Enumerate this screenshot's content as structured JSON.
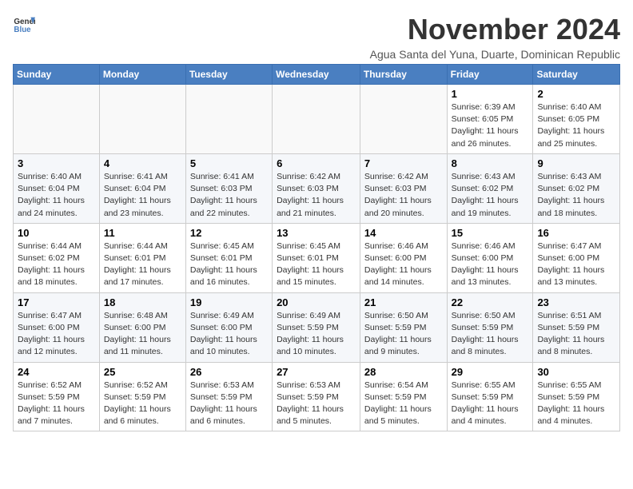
{
  "logo": {
    "general": "General",
    "blue": "Blue"
  },
  "title": "November 2024",
  "subtitle": "Agua Santa del Yuna, Duarte, Dominican Republic",
  "days_header": [
    "Sunday",
    "Monday",
    "Tuesday",
    "Wednesday",
    "Thursday",
    "Friday",
    "Saturday"
  ],
  "weeks": [
    [
      {
        "day": "",
        "info": ""
      },
      {
        "day": "",
        "info": ""
      },
      {
        "day": "",
        "info": ""
      },
      {
        "day": "",
        "info": ""
      },
      {
        "day": "",
        "info": ""
      },
      {
        "day": "1",
        "info": "Sunrise: 6:39 AM\nSunset: 6:05 PM\nDaylight: 11 hours and 26 minutes."
      },
      {
        "day": "2",
        "info": "Sunrise: 6:40 AM\nSunset: 6:05 PM\nDaylight: 11 hours and 25 minutes."
      }
    ],
    [
      {
        "day": "3",
        "info": "Sunrise: 6:40 AM\nSunset: 6:04 PM\nDaylight: 11 hours and 24 minutes."
      },
      {
        "day": "4",
        "info": "Sunrise: 6:41 AM\nSunset: 6:04 PM\nDaylight: 11 hours and 23 minutes."
      },
      {
        "day": "5",
        "info": "Sunrise: 6:41 AM\nSunset: 6:03 PM\nDaylight: 11 hours and 22 minutes."
      },
      {
        "day": "6",
        "info": "Sunrise: 6:42 AM\nSunset: 6:03 PM\nDaylight: 11 hours and 21 minutes."
      },
      {
        "day": "7",
        "info": "Sunrise: 6:42 AM\nSunset: 6:03 PM\nDaylight: 11 hours and 20 minutes."
      },
      {
        "day": "8",
        "info": "Sunrise: 6:43 AM\nSunset: 6:02 PM\nDaylight: 11 hours and 19 minutes."
      },
      {
        "day": "9",
        "info": "Sunrise: 6:43 AM\nSunset: 6:02 PM\nDaylight: 11 hours and 18 minutes."
      }
    ],
    [
      {
        "day": "10",
        "info": "Sunrise: 6:44 AM\nSunset: 6:02 PM\nDaylight: 11 hours and 18 minutes."
      },
      {
        "day": "11",
        "info": "Sunrise: 6:44 AM\nSunset: 6:01 PM\nDaylight: 11 hours and 17 minutes."
      },
      {
        "day": "12",
        "info": "Sunrise: 6:45 AM\nSunset: 6:01 PM\nDaylight: 11 hours and 16 minutes."
      },
      {
        "day": "13",
        "info": "Sunrise: 6:45 AM\nSunset: 6:01 PM\nDaylight: 11 hours and 15 minutes."
      },
      {
        "day": "14",
        "info": "Sunrise: 6:46 AM\nSunset: 6:00 PM\nDaylight: 11 hours and 14 minutes."
      },
      {
        "day": "15",
        "info": "Sunrise: 6:46 AM\nSunset: 6:00 PM\nDaylight: 11 hours and 13 minutes."
      },
      {
        "day": "16",
        "info": "Sunrise: 6:47 AM\nSunset: 6:00 PM\nDaylight: 11 hours and 13 minutes."
      }
    ],
    [
      {
        "day": "17",
        "info": "Sunrise: 6:47 AM\nSunset: 6:00 PM\nDaylight: 11 hours and 12 minutes."
      },
      {
        "day": "18",
        "info": "Sunrise: 6:48 AM\nSunset: 6:00 PM\nDaylight: 11 hours and 11 minutes."
      },
      {
        "day": "19",
        "info": "Sunrise: 6:49 AM\nSunset: 6:00 PM\nDaylight: 11 hours and 10 minutes."
      },
      {
        "day": "20",
        "info": "Sunrise: 6:49 AM\nSunset: 5:59 PM\nDaylight: 11 hours and 10 minutes."
      },
      {
        "day": "21",
        "info": "Sunrise: 6:50 AM\nSunset: 5:59 PM\nDaylight: 11 hours and 9 minutes."
      },
      {
        "day": "22",
        "info": "Sunrise: 6:50 AM\nSunset: 5:59 PM\nDaylight: 11 hours and 8 minutes."
      },
      {
        "day": "23",
        "info": "Sunrise: 6:51 AM\nSunset: 5:59 PM\nDaylight: 11 hours and 8 minutes."
      }
    ],
    [
      {
        "day": "24",
        "info": "Sunrise: 6:52 AM\nSunset: 5:59 PM\nDaylight: 11 hours and 7 minutes."
      },
      {
        "day": "25",
        "info": "Sunrise: 6:52 AM\nSunset: 5:59 PM\nDaylight: 11 hours and 6 minutes."
      },
      {
        "day": "26",
        "info": "Sunrise: 6:53 AM\nSunset: 5:59 PM\nDaylight: 11 hours and 6 minutes."
      },
      {
        "day": "27",
        "info": "Sunrise: 6:53 AM\nSunset: 5:59 PM\nDaylight: 11 hours and 5 minutes."
      },
      {
        "day": "28",
        "info": "Sunrise: 6:54 AM\nSunset: 5:59 PM\nDaylight: 11 hours and 5 minutes."
      },
      {
        "day": "29",
        "info": "Sunrise: 6:55 AM\nSunset: 5:59 PM\nDaylight: 11 hours and 4 minutes."
      },
      {
        "day": "30",
        "info": "Sunrise: 6:55 AM\nSunset: 5:59 PM\nDaylight: 11 hours and 4 minutes."
      }
    ]
  ]
}
